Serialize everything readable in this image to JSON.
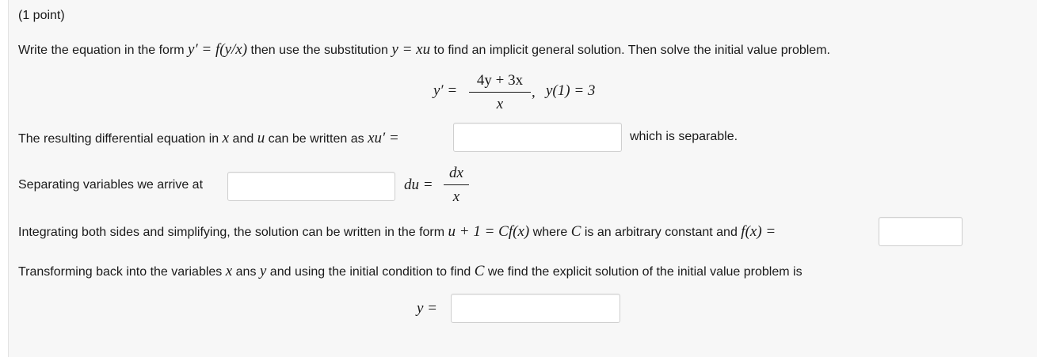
{
  "header": {
    "points": "(1 point)"
  },
  "instructions": {
    "p1": "Write the equation in the form",
    "m1": "y′ = f(y/x)",
    "p2": "then use the substitution",
    "m2": "y = xu",
    "p3": "to find an implicit general solution. Then solve the initial value problem."
  },
  "equation": {
    "lhs": "y′ =",
    "numerator": "4y + 3x",
    "denominator": "x",
    "comma": ",",
    "ic": "y(1) = 3"
  },
  "row1": {
    "p1": "The resulting differential equation in",
    "m1": "x",
    "p2": "and",
    "m2": "u",
    "p3": "can be written as",
    "m3": "xu′ =",
    "after": "which is separable.",
    "input_value": ""
  },
  "row2": {
    "label": "Separating variables we arrive at",
    "input_value": "",
    "du": "du =",
    "frac_num": "dx",
    "frac_den": "x"
  },
  "row3": {
    "p1": "Integrating both sides and simplifying, the solution can be written in the form",
    "m1": "u + 1 = Cf(x)",
    "p2": "where",
    "m2": "C",
    "p3": "is an arbitrary constant and",
    "m3": "f(x) =",
    "input_value": ""
  },
  "row4": {
    "p1": "Transforming back into the variables",
    "m1": "x",
    "p2": "ans",
    "m2": "y",
    "p3": "and using the initial condition to find",
    "m3": "C",
    "p4": "we find the explicit solution of the initial value problem is"
  },
  "row5": {
    "lhs": "y =",
    "input_value": ""
  }
}
